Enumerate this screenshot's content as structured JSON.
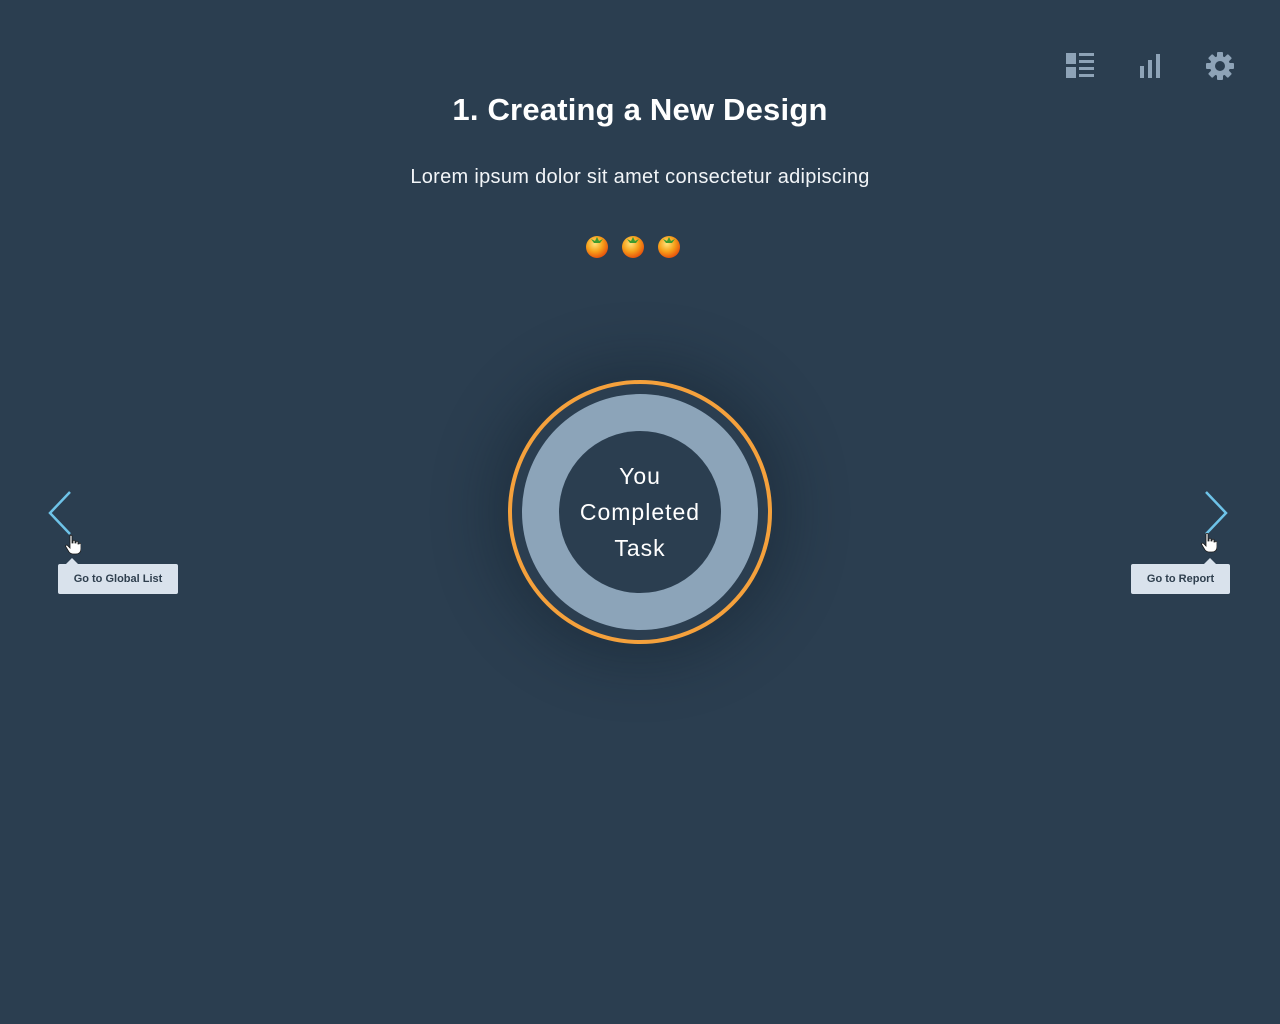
{
  "page": {
    "title": "1. Creating a New Design",
    "subtitle": "Lorem ipsum dolor sit amet consectetur adipiscing"
  },
  "toolbar": {
    "icons": [
      "list-icon",
      "bar-chart-icon",
      "gear-icon"
    ]
  },
  "tomatoes": {
    "count": 3,
    "icon": "tomato-icon"
  },
  "completion": {
    "line1": "You",
    "line2": "Completed",
    "line3": "Task"
  },
  "navigation": {
    "prev_tooltip": "Go to Global List",
    "next_tooltip": "Go to Report"
  },
  "colors": {
    "background": "#2b3e50",
    "accent_ring": "#f5a13c",
    "mid_ring": "#8ca4b9",
    "arrow": "#6ec3e8",
    "icon": "#8ea3b7",
    "tooltip_bg": "#d9e2ec"
  }
}
